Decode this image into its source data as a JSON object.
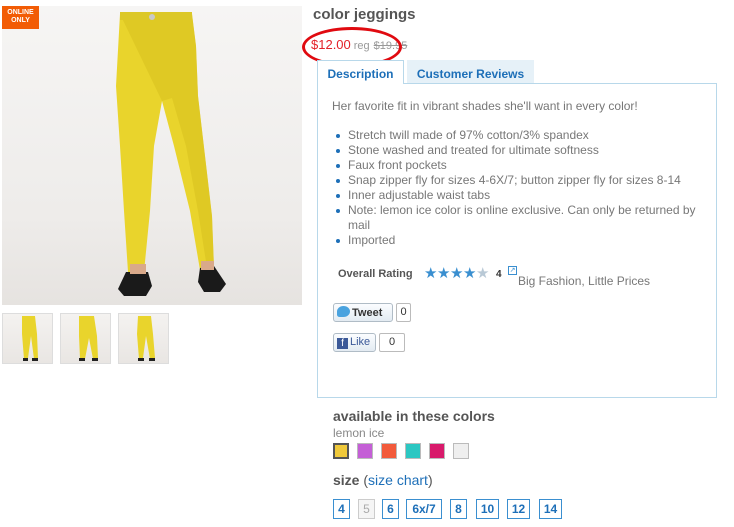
{
  "product": {
    "title": "color jeggings",
    "price": "$12.00",
    "reg_label": "reg",
    "original_price": "$19.95",
    "badge": [
      "ONLINE",
      "ONLY"
    ]
  },
  "tabs": [
    {
      "label": "Description",
      "active": true
    },
    {
      "label": "Customer Reviews",
      "active": false
    }
  ],
  "description": {
    "intro": "Her favorite fit in vibrant shades she'll want in every color!",
    "features": [
      "Stretch twill made of 97% cotton/3% spandex",
      "Stone washed and treated for ultimate softness",
      "Faux front pockets",
      "Snap zipper fly for sizes 4-6X/7; button zipper fly for sizes 8-14",
      "Inner adjustable waist tabs",
      "Note: lemon ice color is online exclusive. Can only be returned by mail",
      "Imported"
    ]
  },
  "rating": {
    "label": "Overall Rating",
    "value": 4,
    "max": 5,
    "count_text": "4",
    "review_headline": "Big Fashion, Little Prices"
  },
  "social": {
    "tweet_label": "Tweet",
    "tweet_count": "0",
    "like_label": "Like",
    "like_count": "0"
  },
  "colors": {
    "heading": "available in these colors",
    "selected": "lemon ice",
    "swatches": [
      "#f0c93a",
      "#c45fd6",
      "#f25a3b",
      "#2cc7c2",
      "#d81a6b",
      "#efefef"
    ]
  },
  "sizes": {
    "heading": "size",
    "open_paren": "(",
    "chart_link": "size chart",
    "close_paren": ")",
    "options": [
      {
        "label": "4",
        "available": true
      },
      {
        "label": "5",
        "available": false
      },
      {
        "label": "6",
        "available": true
      },
      {
        "label": "6x/7",
        "available": true
      },
      {
        "label": "8",
        "available": true
      },
      {
        "label": "10",
        "available": true
      },
      {
        "label": "12",
        "available": true
      },
      {
        "label": "14",
        "available": true
      }
    ]
  },
  "accent": {
    "price_red": "#e32028",
    "link_blue": "#1d6fb8",
    "jeans_yellow": "#e8d22a"
  }
}
